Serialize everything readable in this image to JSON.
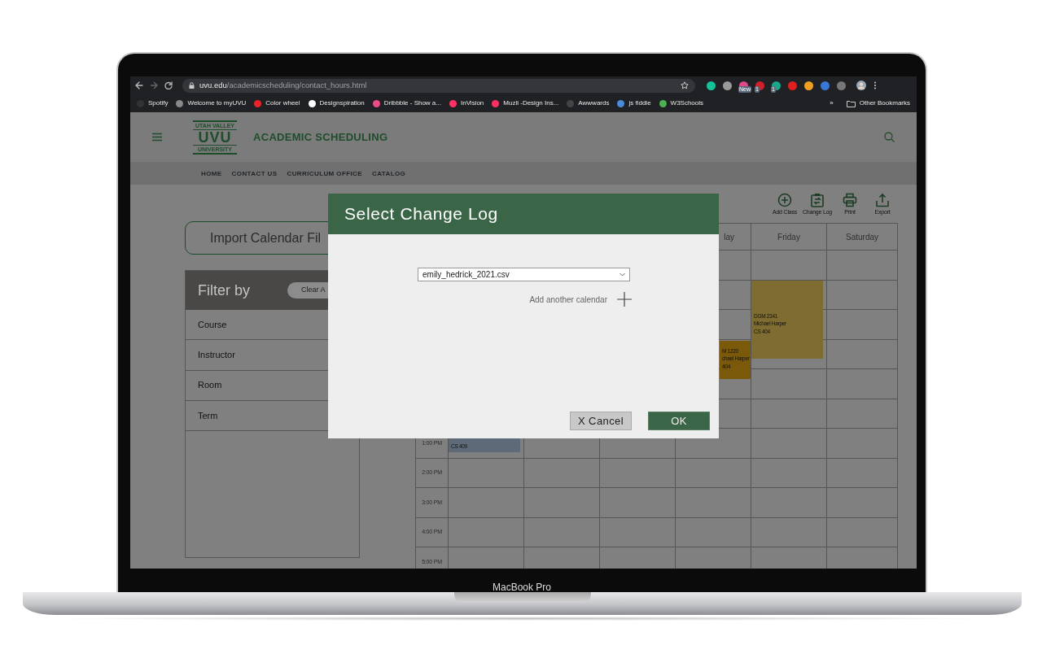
{
  "browser": {
    "url_domain": "uvu.edu",
    "url_path": "/academicscheduling/contact_hours.html",
    "extensions": [
      {
        "color": "#15c39a"
      },
      {
        "color": "#9a9a9a"
      },
      {
        "color": "#e04a8a",
        "badge": "New"
      },
      {
        "color": "#d0202a",
        "badge": "1"
      },
      {
        "color": "#1aa88a",
        "badge": "1"
      },
      {
        "color": "#e0201e"
      },
      {
        "color": "#f0a020"
      },
      {
        "color": "#3a78d8"
      },
      {
        "color": "#777777"
      }
    ],
    "bookmarks": [
      {
        "label": "Spotify",
        "color": "#333333"
      },
      {
        "label": "Welcome to myUVU",
        "color": "#888888"
      },
      {
        "label": "Color wheel",
        "color": "#e8242a"
      },
      {
        "label": "Designspiration",
        "color": "#ffffff"
      },
      {
        "label": "Dribbble - Show a...",
        "color": "#ea4c89"
      },
      {
        "label": "InVision",
        "color": "#ff3366"
      },
      {
        "label": "Muzli -Design Ins...",
        "color": "#ff2e63"
      },
      {
        "label": "Awwwards",
        "color": "#444444"
      },
      {
        "label": "js fiddle",
        "color": "#4a8ad8"
      },
      {
        "label": "W3Schools",
        "color": "#4caf50"
      }
    ],
    "overflow": "»",
    "other_bookmarks": "Other Bookmarks"
  },
  "site": {
    "logo_top": "UTAH VALLEY",
    "logo_main": "UVU",
    "logo_bottom": "UNIVERSITY",
    "title": "ACADEMIC SCHEDULING",
    "nav": [
      "HOME",
      "CONTACT US",
      "CURRICULUM OFFICE",
      "CATALOG"
    ]
  },
  "import_button": "Import Calendar Fil",
  "filter": {
    "title": "Filter by",
    "clear": "Clear A",
    "items": [
      "Course",
      "Instructor",
      "Room",
      "Term"
    ]
  },
  "toolbar": [
    {
      "kind": "add",
      "label": "Add Class"
    },
    {
      "kind": "change-log",
      "label": "Change Log"
    },
    {
      "kind": "print",
      "label": "Print"
    },
    {
      "kind": "export",
      "label": "Export"
    }
  ],
  "calendar": {
    "day_headers": [
      "lay",
      "Friday",
      "Saturday"
    ],
    "times": [
      "1:00 PM",
      "2:00 PM",
      "3:00 PM",
      "4:00 PM",
      "5:00 PM"
    ],
    "events": [
      {
        "lines": [
          "CS 409"
        ],
        "color": "#5e6a78"
      },
      {
        "lines": [
          "M 1220",
          "chael Harper",
          "404"
        ],
        "color": "#7a5a0a"
      },
      {
        "lines": [
          "DGM 2341",
          "Michael Harper",
          "CS 404"
        ],
        "color": "#7f6c30"
      }
    ]
  },
  "modal": {
    "title": "Select Change Log",
    "file_value": "emily_hedrick_2021.csv",
    "add_label": "Add another calendar",
    "cancel": "X Cancel",
    "ok": "OK"
  },
  "device_label": "MacBook Pro"
}
